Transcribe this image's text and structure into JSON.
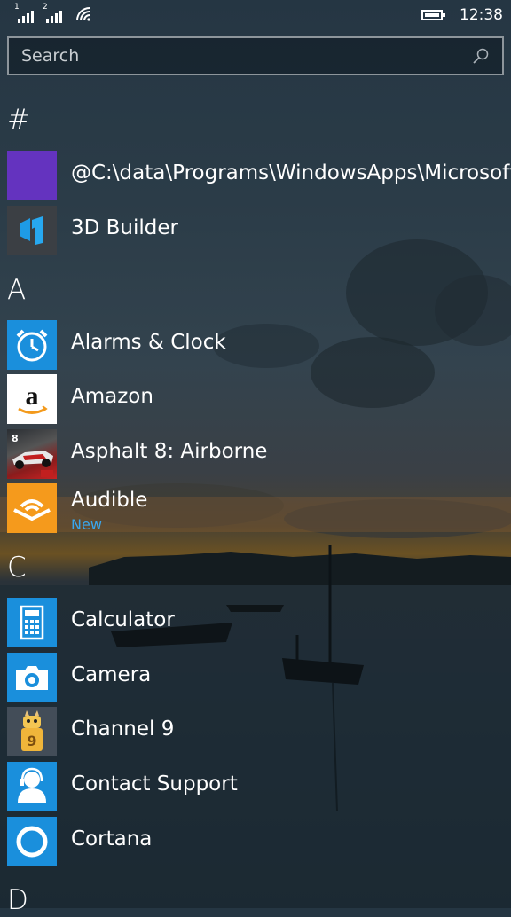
{
  "status": {
    "sim1": "1",
    "sim2": "2",
    "time": "12:38"
  },
  "search": {
    "placeholder": "Search"
  },
  "groups": {
    "hash": "#",
    "a": "A",
    "c": "C",
    "d": "D"
  },
  "apps": [
    {
      "name": "@C:\\data\\Programs\\WindowsApps\\Microsoft",
      "tile_color": "#6433bf",
      "icon": "blank-icon"
    },
    {
      "name": "3D Builder",
      "tile_color": "#3b3f44",
      "icon": "3d-builder-icon"
    },
    {
      "name": "Alarms & Clock",
      "tile_color": "#1a8fdc",
      "icon": "alarm-clock-icon"
    },
    {
      "name": "Amazon",
      "tile_color": "#ffffff",
      "icon": "amazon-icon"
    },
    {
      "name": "Asphalt 8: Airborne",
      "tile_color": "#8b1c1c",
      "icon": "race-car-icon"
    },
    {
      "name": "Audible",
      "sub": "New",
      "tile_color": "#f59a1c",
      "icon": "audible-icon"
    },
    {
      "name": "Calculator",
      "tile_color": "#1a8fdc",
      "icon": "calculator-icon"
    },
    {
      "name": "Camera",
      "tile_color": "#1a8fdc",
      "icon": "camera-icon"
    },
    {
      "name": "Channel 9",
      "tile_color": "#434d58",
      "icon": "channel9-mascot-icon"
    },
    {
      "name": "Contact Support",
      "tile_color": "#1a8fdc",
      "icon": "support-person-icon"
    },
    {
      "name": "Cortana",
      "tile_color": "#1a8fdc",
      "icon": "cortana-circle-icon"
    }
  ]
}
